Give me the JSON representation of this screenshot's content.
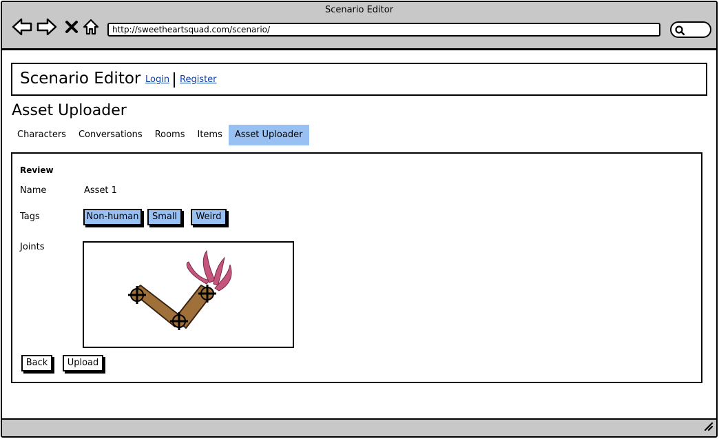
{
  "browser": {
    "window_title": "Scenario Editor",
    "url": "http://sweetheartsquad.com/scenario/"
  },
  "header": {
    "app_title": "Scenario Editor",
    "login_label": "Login",
    "register_label": "Register"
  },
  "page": {
    "title": "Asset Uploader"
  },
  "tabs": [
    {
      "label": "Characters"
    },
    {
      "label": "Conversations"
    },
    {
      "label": "Rooms"
    },
    {
      "label": "Items"
    },
    {
      "label": "Asset Uploader",
      "active": true
    }
  ],
  "review": {
    "section_label": "Review",
    "name_label": "Name",
    "name_value": "Asset 1",
    "tags_label": "Tags",
    "tags": [
      "Non-human",
      "Small",
      "Weird"
    ],
    "joints_label": "Joints"
  },
  "actions": {
    "back_label": "Back",
    "upload_label": "Upload"
  },
  "colors": {
    "chrome": "#c8c8c8",
    "accent": "#99c0f2",
    "link": "#0b3fa6",
    "limb": "#a0703a",
    "flame": "#c4557d"
  }
}
